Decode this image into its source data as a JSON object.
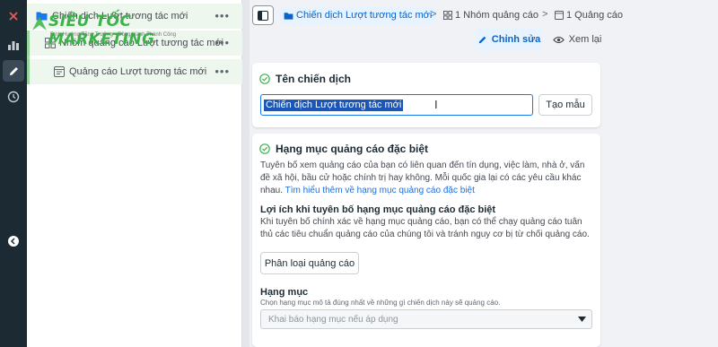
{
  "watermark": {
    "brand": "SIÊU TỐC MARKETING",
    "tagline": "Định Hướng Tăng Trưởng - Đồng Hành Thành Công"
  },
  "rail": {
    "icons": [
      "close-icon",
      "chart-icon",
      "pencil-icon",
      "clock-icon",
      "collapse-icon"
    ]
  },
  "tree": {
    "items": [
      {
        "label": "Chiến dịch Lượt tương tác mới",
        "icon": "folder-icon",
        "more": "•••"
      },
      {
        "label": "Nhóm quảng cáo Lượt tương tác mới",
        "icon": "grid-icon",
        "more": "•••"
      },
      {
        "label": "Quảng cáo Lượt tương tác mới",
        "icon": "ad-icon",
        "more": "•••"
      }
    ]
  },
  "breadcrumb": {
    "campaign": "Chiến dịch Lượt tương tác mới",
    "adset": "1 Nhóm quảng cáo",
    "ad": "1 Quảng cáo",
    "sep": ">"
  },
  "actions": {
    "edit": "Chỉnh sửa",
    "review": "Xem lại"
  },
  "campaign_name": {
    "title": "Tên chiến dịch",
    "value": "Chiến dịch Lượt tương tác mới",
    "template_button": "Tạo mẫu"
  },
  "special_category": {
    "title": "Hạng mục quảng cáo đặc biệt",
    "description": "Tuyên bố xem quảng cáo của bạn có liên quan đến tín dụng, việc làm, nhà ở, vấn đề xã hội, bầu cử hoặc chính trị hay không. Mỗi quốc gia lại có các yêu cầu khác nhau. ",
    "learn_more": "Tìm hiểu thêm về hạng mục quảng cáo đặc biệt",
    "benefit_title": "Lợi ích khi tuyên bố hạng mục quảng cáo đặc biệt",
    "benefit_text": "Khi tuyên bố chính xác về hạng mục quảng cáo, bạn có thể chạy quảng cáo tuân thủ các tiêu chuẩn quảng cáo của chúng tôi và tránh nguy cơ bị từ chối quảng cáo.",
    "classify_button": "Phân loại quảng cáo",
    "field_label": "Hạng mục",
    "field_help": "Chọn hạng mục mô tả đúng nhất về những gì chiến dịch này sẽ quảng cáo.",
    "select_placeholder": "Khai báo hạng mục nếu áp dụng"
  },
  "colors": {
    "accent": "#1877f2",
    "link": "#216fdb",
    "success": "#3bb34a",
    "rail": "#1c2b33"
  }
}
